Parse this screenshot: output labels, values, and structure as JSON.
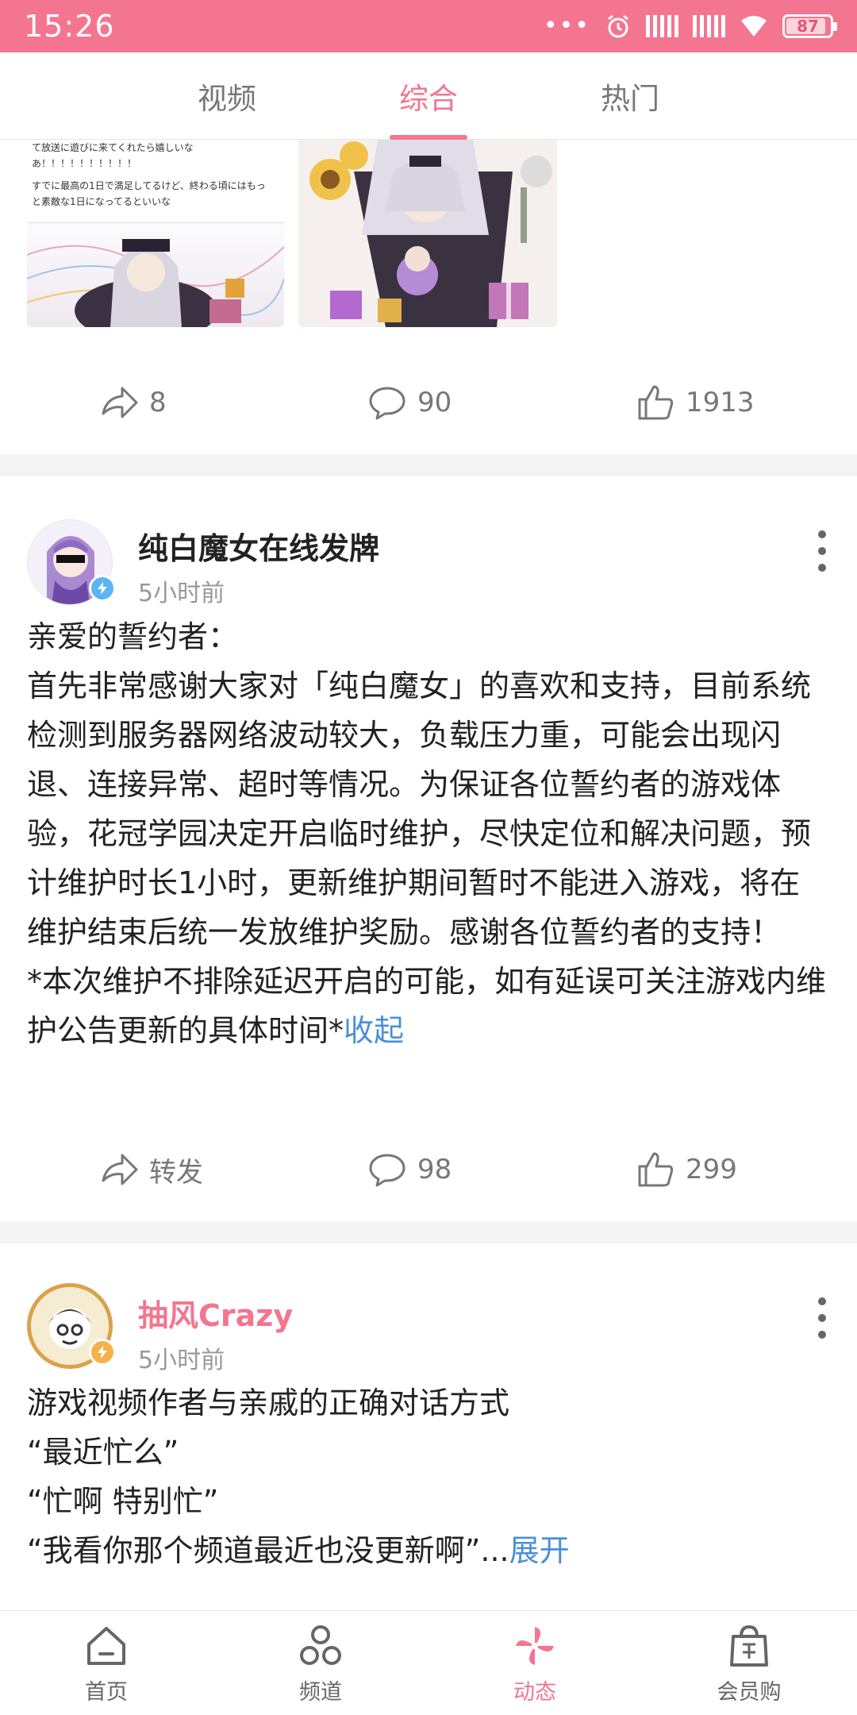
{
  "status_bar": {
    "time": "15:26",
    "battery": "87",
    "battery_level": 0.87,
    "icons": [
      "more-dots-icon",
      "alarm-icon",
      "signal-icon",
      "signal-icon",
      "wifi-icon",
      "battery-icon"
    ]
  },
  "tabs": [
    {
      "label": "视频",
      "active": false
    },
    {
      "label": "综合",
      "active": true
    },
    {
      "label": "热门",
      "active": false
    }
  ],
  "card1": {
    "thumb_text": [
      "て放送に遊びに来てくれたら嬉しいな",
      "あ！！！！！！！！！！",
      "すでに最高の1日で満足してるけど、終わる頃にはもっ",
      "と素敵な1日になってるといいな"
    ],
    "share_count": "8",
    "comment_count": "90",
    "like_count": "1913"
  },
  "post2": {
    "author": "纯白魔女在线发牌",
    "time": "5小时前",
    "paragraphs": [
      "亲爱的誓约者：",
      "首先非常感谢大家对「纯白魔女」的喜欢和支持，目前系统检测到服务器网络波动较大，负载压力重，可能会出现闪退、连接异常、超时等情况。为保证各位誓约者的游戏体验，花冠学园决定开启临时维护，尽快定位和解决问题，预计维护时长1小时，更新维护期间暂时不能进入游戏，将在维护结束后统一发放维护奖励。感谢各位誓约者的支持！"
    ],
    "last_line": "*本次维护不排除延迟开启的可能，如有延误可关注游戏内维护公告更新的具体时间*",
    "collapse_label": "收起",
    "share_label": "转发",
    "comment_count": "98",
    "like_count": "299"
  },
  "post3": {
    "author": "抽风Crazy",
    "time": "5小时前",
    "lines": [
      "游戏视频作者与亲戚的正确对话方式",
      "“最近忙么”",
      "“忙啊 特别忙”"
    ],
    "last_line": "“我看你那个频道最近也没更新啊”...",
    "expand_label": "展开"
  },
  "bottom_nav": [
    {
      "label": "首页",
      "icon": "home-icon",
      "active": false
    },
    {
      "label": "频道",
      "icon": "channel-icon",
      "active": false
    },
    {
      "label": "动态",
      "icon": "pinwheel-icon",
      "active": true
    },
    {
      "label": "会员购",
      "icon": "shopping-bag-icon",
      "active": false
    }
  ],
  "colors": {
    "accent": "#f4758f",
    "link": "#4a8fd8",
    "verify_blue": "#5ab4f5",
    "verify_orange": "#f6b24a"
  }
}
